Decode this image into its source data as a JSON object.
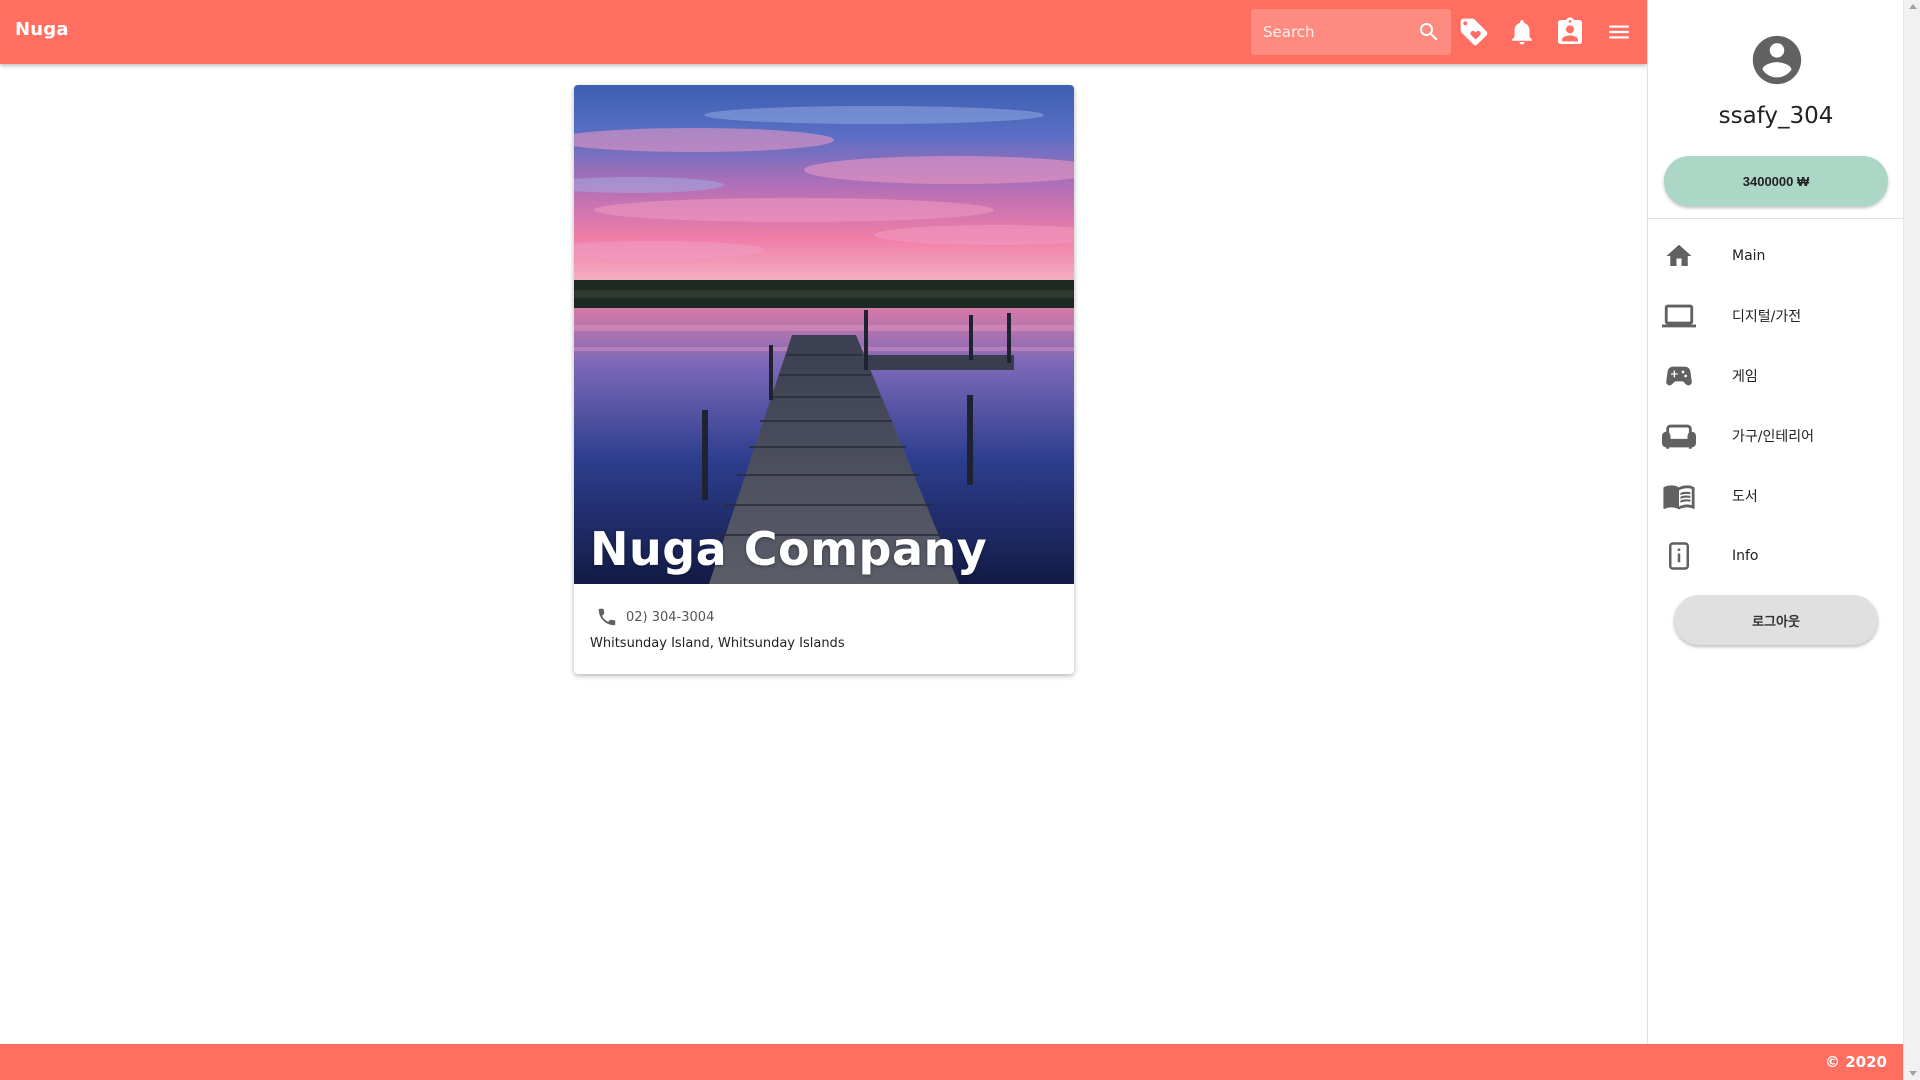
{
  "topbar": {
    "brand": "Nuga",
    "search_placeholder": "Search",
    "icons": [
      "search-icon",
      "tag-heart-icon",
      "bell-icon",
      "assignment-ind-icon",
      "menu-icon"
    ],
    "color": "#ff6e61"
  },
  "card": {
    "title": "Nuga Company",
    "phone": "02) 304-3004",
    "address": "Whitsunday Island, Whitsunday Islands",
    "image": "sunset-lake-dock-photo"
  },
  "drawer": {
    "username": "ssafy_304",
    "balance": "3400000 ₩",
    "balance_color": "#acd6c5",
    "items": [
      {
        "label": "Main",
        "icon": "home-icon"
      },
      {
        "label": "디지털/가전",
        "icon": "laptop-icon"
      },
      {
        "label": "게임",
        "icon": "gamepad-icon"
      },
      {
        "label": "가구/인테리어",
        "icon": "sofa-icon"
      },
      {
        "label": "도서",
        "icon": "book-icon"
      },
      {
        "label": "Info",
        "icon": "info-icon"
      }
    ],
    "logout": "로그아웃"
  },
  "footer": {
    "text": "© 2020"
  }
}
